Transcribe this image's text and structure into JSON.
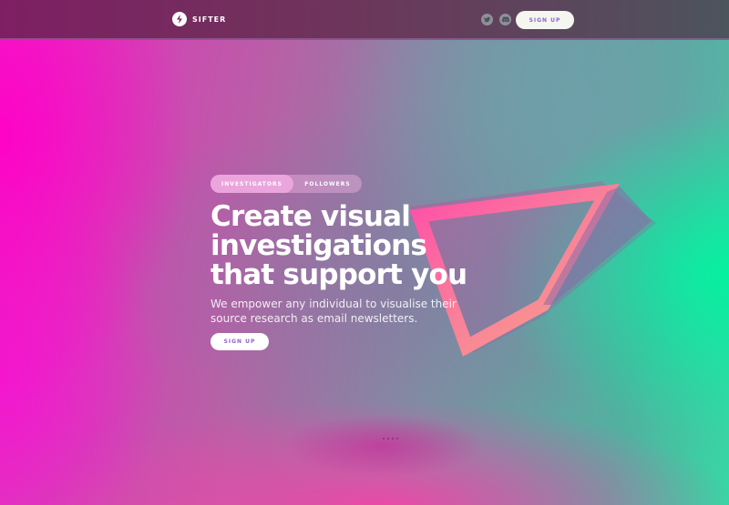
{
  "brand": {
    "name": "SIFTER"
  },
  "nav": {
    "social": [
      {
        "icon": "twitter-icon"
      },
      {
        "icon": "discord-icon"
      }
    ],
    "signup_label": "SIGN UP"
  },
  "hero": {
    "tabs": [
      {
        "label": "INVESTIGATORS",
        "active": true
      },
      {
        "label": "FOLLOWERS",
        "active": false
      }
    ],
    "headline_lines": [
      "Create visual",
      "investigations",
      "that support you"
    ],
    "subtext_lines": [
      "We empower any individual to visualise their",
      "source research as email newsletters."
    ],
    "signup_label": "SIGN UP"
  },
  "colors": {
    "button_text": "#8c63d0",
    "accent_pink": "#ff00c8",
    "accent_green": "#00f5a0"
  }
}
